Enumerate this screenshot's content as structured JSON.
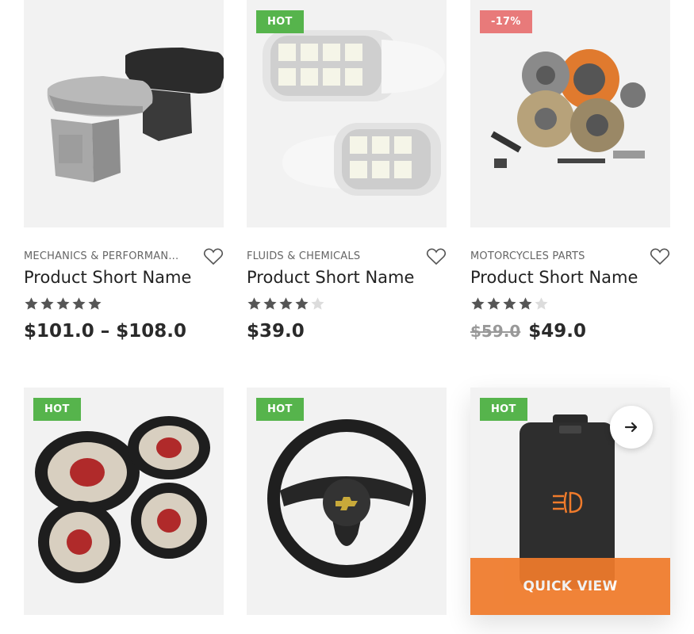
{
  "products": [
    {
      "category": "MECHANICS & PERFORMAN...",
      "name": "Product Short Name",
      "rating": 5,
      "price": "$101.0 – $108.0",
      "old_price": "",
      "badge": "",
      "image": "armrest"
    },
    {
      "category": "FLUIDS & CHEMICALS",
      "name": "Product Short Name",
      "rating": 4,
      "price": "$39.0",
      "old_price": "",
      "badge": "HOT",
      "image": "led-bulbs"
    },
    {
      "category": "MOTORCYCLES PARTS",
      "name": "Product Short Name",
      "rating": 4,
      "price": "$49.0",
      "old_price": "$59.0",
      "badge": "-17%",
      "image": "clutch-kit"
    },
    {
      "badge": "HOT",
      "image": "speakers"
    },
    {
      "badge": "HOT",
      "image": "steering-wheel"
    },
    {
      "badge": "HOT",
      "image": "fog-light-switch",
      "quick_view_label": "QUICK VIEW"
    }
  ],
  "colors": {
    "hot_badge": "#56b44c",
    "sale_badge": "#e87a7a",
    "quick_view": "#f07b2b",
    "star_on": "#555555",
    "star_off": "#dcdcdc"
  },
  "icons": {
    "wishlist": "heart-icon",
    "rating": "star-icon",
    "next": "arrow-right-icon"
  }
}
